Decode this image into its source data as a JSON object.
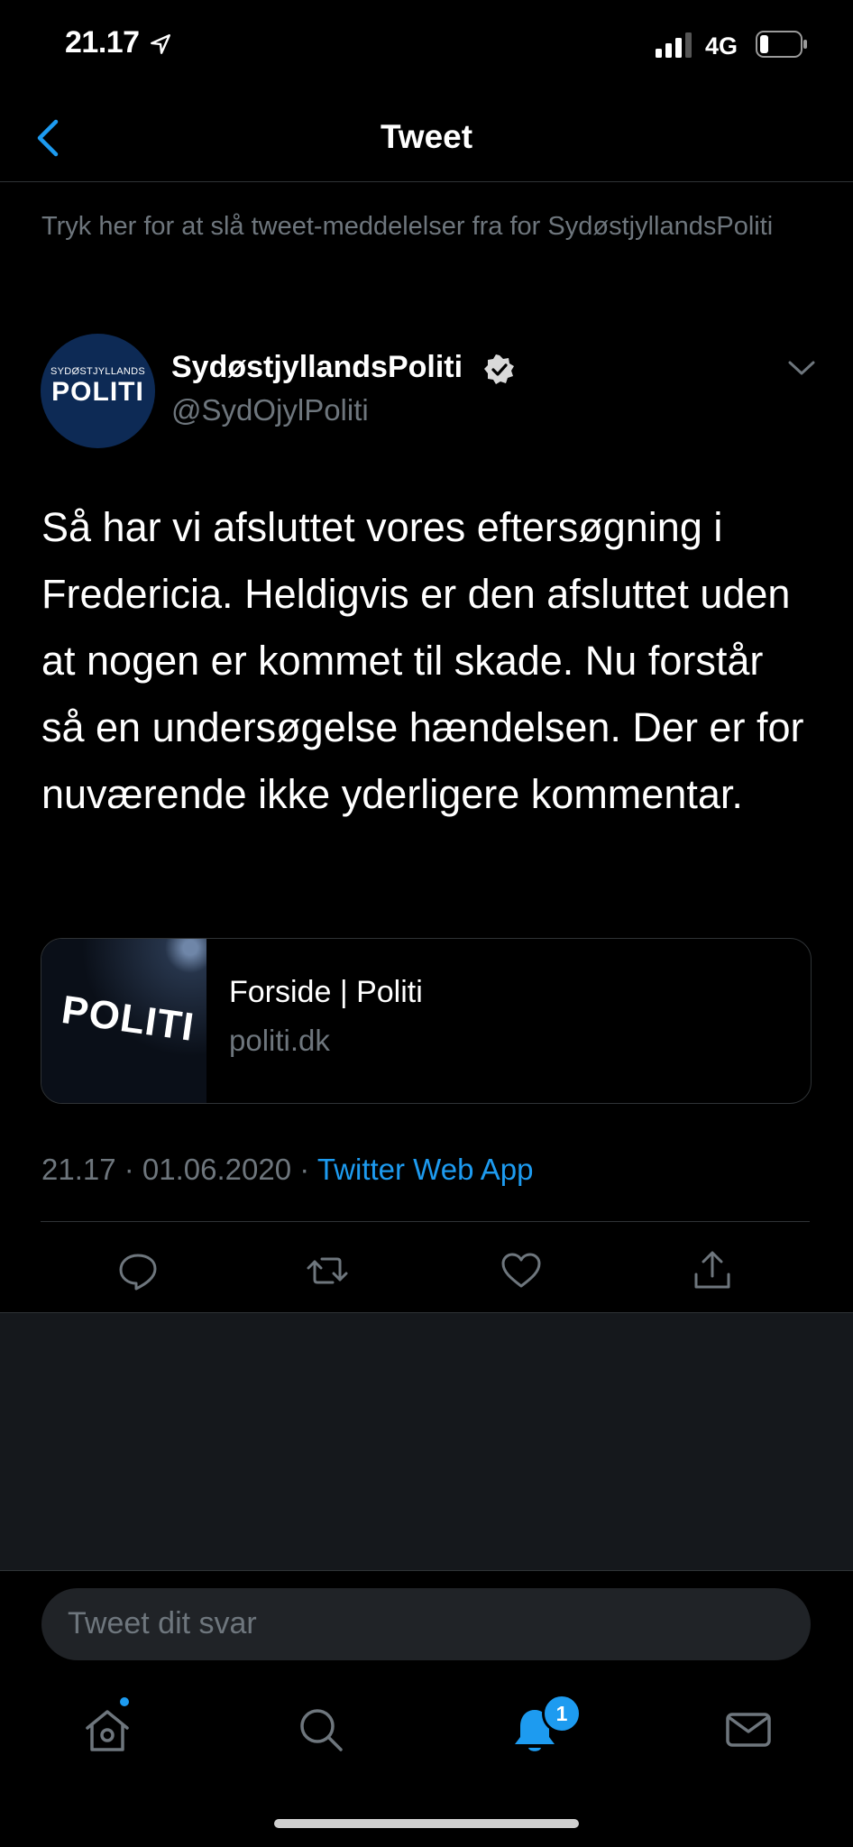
{
  "status_bar": {
    "time": "21.17",
    "network": "4G"
  },
  "header": {
    "title": "Tweet"
  },
  "notice": "Tryk her for at slå tweet-meddelelser fra for SydøstjyllandsPoliti",
  "tweet": {
    "avatar_small": "SYDØSTJYLLANDS",
    "avatar_big": "POLITI",
    "author_name": "SydøstjyllandsPoliti",
    "author_handle": "@SydOjylPoliti",
    "text": "Så har vi afsluttet vores eftersøgning i Fredericia. Heldigvis er den afsluttet uden at nogen er kommet til skade. Nu forstår så en undersøgelse hændelsen. Der er for nuværende ikke yderligere kommentar.",
    "card": {
      "image_text": "POLITI",
      "title": "Forside | Politi",
      "domain": "politi.dk"
    },
    "timestamp": "21.17 · 01.06.2020 · ",
    "source_app": "Twitter Web App"
  },
  "reply": {
    "placeholder": "Tweet dit svar"
  },
  "tabs": {
    "notifications_badge": "1"
  },
  "colors": {
    "accent": "#1d9bf0",
    "background": "#000000",
    "secondary_text": "#6e767d"
  },
  "icons": [
    "location-arrow-icon",
    "signal-icon",
    "battery-icon",
    "back-chevron-icon",
    "verified-icon",
    "chevron-down-icon",
    "reply-icon",
    "retweet-icon",
    "like-icon",
    "share-icon",
    "home-icon",
    "search-icon",
    "bell-icon",
    "mail-icon"
  ]
}
